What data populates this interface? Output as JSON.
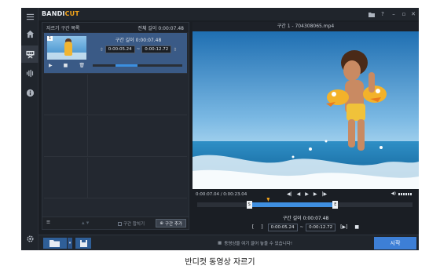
{
  "app": {
    "logo_part1": "BANDI",
    "logo_part2": "CUT",
    "window_controls": [
      "folder-icon",
      "help-icon",
      "minimize-icon",
      "maximize-icon",
      "close-icon"
    ],
    "accent_color": "#3d7fd6",
    "brand_color": "#f2a31b"
  },
  "sidebar": {
    "items": [
      {
        "icon": "menu-icon"
      },
      {
        "icon": "home-icon"
      },
      {
        "icon": "scissors-icon",
        "active": true
      },
      {
        "icon": "audio-waveform-icon"
      },
      {
        "icon": "info-icon"
      },
      {
        "icon": "settings-gear-icon"
      }
    ]
  },
  "segments": {
    "header_left": "자르기 구간 목록",
    "header_right": "전체 길이 0:00:07.48",
    "items": [
      {
        "number": "1",
        "length_label": "구간 길이 0:00:07.48",
        "start": "0:00:05.24",
        "end": "0:00:12.72",
        "mini_progress": 0.25
      }
    ],
    "footer": {
      "merge_label": "구간 합치기",
      "add_label": "구간 추가"
    }
  },
  "preview": {
    "title": "구간 1 - 704308065.mp4",
    "time_display": "0:00:07.04 / 0:00:23.04",
    "selection_start_fraction": 0.24,
    "selection_end_fraction": 0.64,
    "playhead_fraction": 0.33,
    "handle_start_label": "S",
    "handle_end_label": "E",
    "length_label": "구간 길이 0:00:07.48",
    "range_start": "0:00:05.24",
    "range_end": "0:00:12.72"
  },
  "bottom": {
    "hint": "동영상을 여기 끌어 놓을 수 있습니다!",
    "start_label": "시작"
  },
  "caption": "반디컷 동영상 자르기"
}
